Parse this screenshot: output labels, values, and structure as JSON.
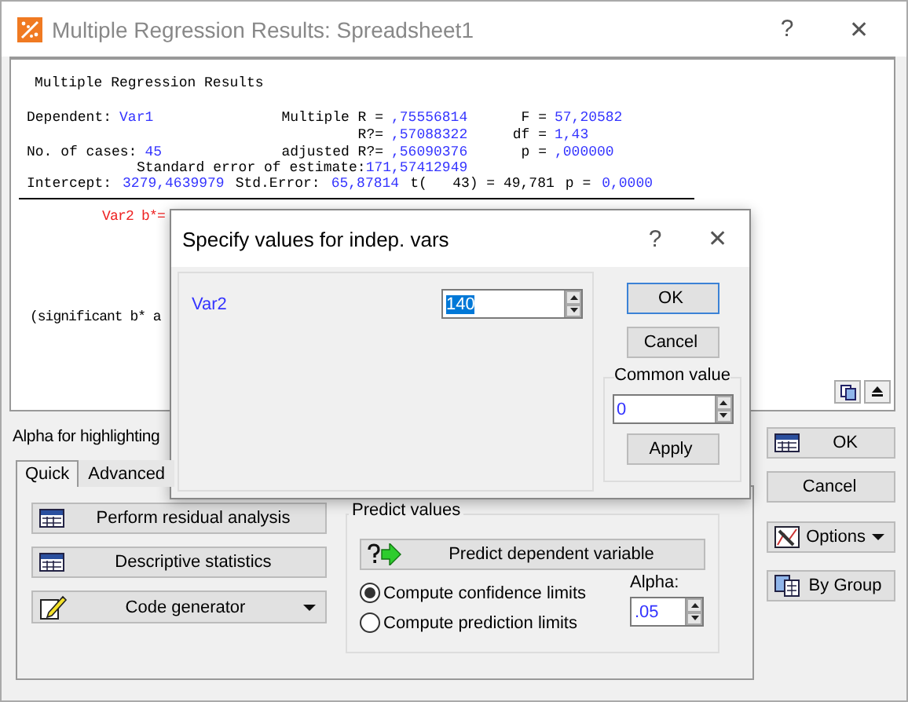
{
  "window": {
    "title": "Multiple Regression Results: Spreadsheet1",
    "help": "?",
    "close": "✕"
  },
  "report": {
    "title": "Multiple Regression Results",
    "stats": [
      {
        "c1": [
          "Dependent:",
          "Var1"
        ],
        "c2": [
          "Multiple R =",
          ",75556814"
        ],
        "c3": [
          "F =",
          "57,20582"
        ]
      },
      {
        "c2": [
          "R?=",
          ",57088322"
        ],
        "c3": [
          "df =",
          "1,43"
        ]
      },
      {
        "c1": [
          "No. of cases:",
          "45"
        ],
        "c2": [
          "adjusted R?=",
          ",56090376"
        ],
        "c3": [
          "p =",
          ",000000"
        ]
      }
    ],
    "std_error": {
      "label": "Standard error of estimate:",
      "value": "171,57412949"
    },
    "intercept": [
      {
        "text": "Intercept:",
        "kind": "label"
      },
      {
        "text": "3279,4639979",
        "kind": "value"
      },
      {
        "text": "Std.Error:",
        "kind": "label"
      },
      {
        "text": "65,87814",
        "kind": "value"
      },
      {
        "text": "t(   43) = 49,781",
        "kind": "label"
      },
      {
        "text": "p =",
        "kind": "label"
      },
      {
        "text": "0,0000",
        "kind": "value"
      }
    ],
    "coef": "Var2 b*=",
    "note": "(significant b* a"
  },
  "alpha_label": "Alpha for highlighting",
  "tabs": [
    {
      "label": "Quick",
      "selected": true
    },
    {
      "label": "Advanced",
      "selected": false
    }
  ],
  "actions": [
    {
      "label": "Perform residual analysis",
      "kind": "plain"
    },
    {
      "label": "Descriptive statistics",
      "kind": "plain"
    },
    {
      "label": "Code generator",
      "kind": "menu"
    }
  ],
  "predict": {
    "title": "Predict values",
    "button": "Predict dependent variable",
    "options": [
      {
        "label": "Compute confidence limits",
        "selected": true
      },
      {
        "label": "Compute prediction limits",
        "selected": false
      }
    ],
    "alpha_label": "Alpha:",
    "alpha": ".05"
  },
  "side_buttons": [
    {
      "label": "OK",
      "kind": "plain"
    },
    {
      "label": "Cancel",
      "kind": "plain"
    },
    {
      "label": "Options",
      "kind": "menu"
    },
    {
      "label": "By Group",
      "kind": "plain"
    }
  ],
  "dialog": {
    "title": "Specify values for indep. vars",
    "help": "?",
    "close": "✕",
    "vars": [
      {
        "name": "Var2",
        "value": "140"
      }
    ],
    "ok": "OK",
    "cancel": "Cancel",
    "common_title": "Common value",
    "common_value": "0",
    "apply": "Apply"
  }
}
